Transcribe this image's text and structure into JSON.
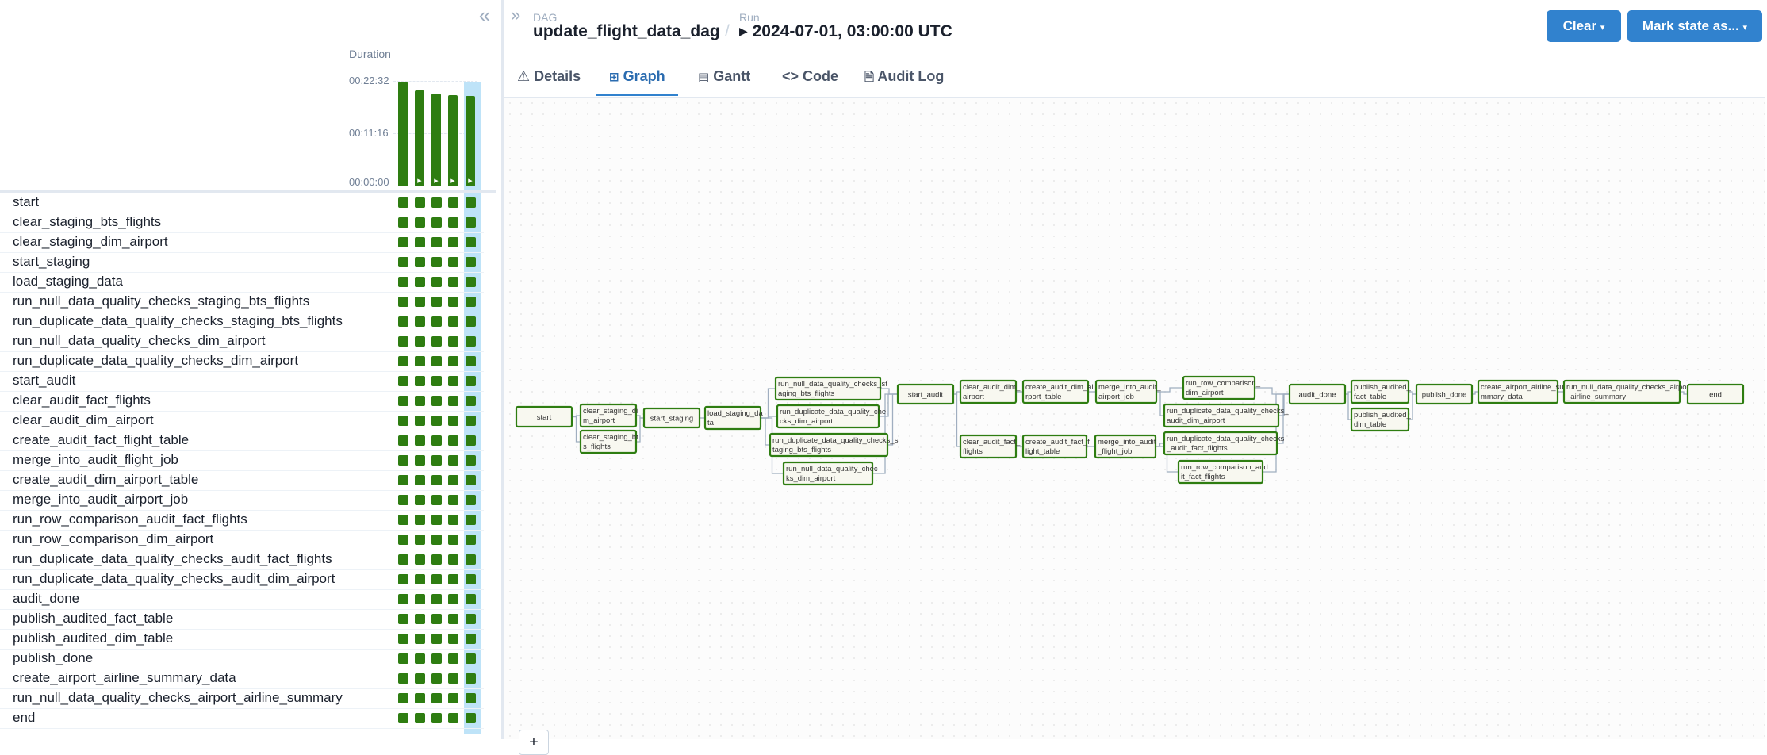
{
  "grid": {
    "duration_label": "Duration",
    "ticks": [
      "00:22:32",
      "00:11:16",
      "00:00:00"
    ],
    "runs": [
      {
        "duration_fraction": 1.0,
        "has_play": false
      },
      {
        "duration_fraction": 0.92,
        "has_play": true
      },
      {
        "duration_fraction": 0.89,
        "has_play": true
      },
      {
        "duration_fraction": 0.87,
        "has_play": true
      },
      {
        "duration_fraction": 0.86,
        "has_play": true
      }
    ],
    "tasks": [
      "start",
      "clear_staging_bts_flights",
      "clear_staging_dim_airport",
      "start_staging",
      "load_staging_data",
      "run_null_data_quality_checks_staging_bts_flights",
      "run_duplicate_data_quality_checks_staging_bts_flights",
      "run_null_data_quality_checks_dim_airport",
      "run_duplicate_data_quality_checks_dim_airport",
      "start_audit",
      "clear_audit_fact_flights",
      "clear_audit_dim_airport",
      "create_audit_fact_flight_table",
      "merge_into_audit_flight_job",
      "create_audit_dim_airport_table",
      "merge_into_audit_airport_job",
      "run_row_comparison_audit_fact_flights",
      "run_row_comparison_dim_airport",
      "run_duplicate_data_quality_checks_audit_fact_flights",
      "run_duplicate_data_quality_checks_audit_dim_airport",
      "audit_done",
      "publish_audited_fact_table",
      "publish_audited_dim_table",
      "publish_done",
      "create_airport_airline_summary_data",
      "run_null_data_quality_checks_airport_airline_summary",
      "end"
    ]
  },
  "header": {
    "dag_label": "DAG",
    "dag_id": "update_flight_data_dag",
    "run_label": "Run",
    "run_id": "2024-07-01, 03:00:00 UTC",
    "clear_button": "Clear",
    "mark_state_button": "Mark state as..."
  },
  "tabs": [
    "Details",
    "Graph",
    "Gantt",
    "Code",
    "Audit Log"
  ],
  "active_tab": "Graph",
  "colors": {
    "success": "#2e7d11",
    "accent": "#3182ce",
    "node_fill": "#f8f8f0"
  },
  "graph": {
    "zoom_in": "+",
    "nodes": [
      {
        "id": "start",
        "lines": [
          "start"
        ]
      },
      {
        "id": "clear_staging_dim_airport",
        "lines": [
          "clear_staging_di",
          "m_airport"
        ]
      },
      {
        "id": "clear_staging_bts_flights",
        "lines": [
          "clear_staging_bt",
          "s_flights"
        ]
      },
      {
        "id": "start_staging",
        "lines": [
          "start_staging"
        ]
      },
      {
        "id": "load_staging_data",
        "lines": [
          "load_staging_da",
          "ta"
        ]
      },
      {
        "id": "null_stg_bts",
        "lines": [
          "run_null_data_quality_checks_st",
          "aging_bts_flights"
        ]
      },
      {
        "id": "dup_dim_airport",
        "lines": [
          "run_duplicate_data_quality_che",
          "cks_dim_airport"
        ]
      },
      {
        "id": "dup_stg_bts",
        "lines": [
          "run_duplicate_data_quality_checks_s",
          "taging_bts_flights"
        ]
      },
      {
        "id": "null_dim_airport",
        "lines": [
          "run_null_data_quality_chec",
          "ks_dim_airport"
        ]
      },
      {
        "id": "start_audit",
        "lines": [
          "start_audit"
        ]
      },
      {
        "id": "clear_audit_dim_airport",
        "lines": [
          "clear_audit_dim_",
          "airport"
        ]
      },
      {
        "id": "create_audit_dim_airport_table",
        "lines": [
          "create_audit_dim_ai",
          "rport_table"
        ]
      },
      {
        "id": "merge_into_audit_airport_job",
        "lines": [
          "merge_into_audit_",
          "airport_job"
        ]
      },
      {
        "id": "row_cmp_dim",
        "lines": [
          "run_row_comparison_",
          "dim_airport"
        ]
      },
      {
        "id": "dup_audit_dim",
        "lines": [
          "run_duplicate_data_quality_checks_",
          "audit_dim_airport"
        ]
      },
      {
        "id": "clear_audit_fact_flights",
        "lines": [
          "clear_audit_fact_",
          "flights"
        ]
      },
      {
        "id": "create_audit_fact_flight_table",
        "lines": [
          "create_audit_fact_f",
          "light_table"
        ]
      },
      {
        "id": "merge_into_audit_flight_job",
        "lines": [
          "merge_into_audit",
          "_flight_job"
        ]
      },
      {
        "id": "dup_audit_fact",
        "lines": [
          "run_duplicate_data_quality_checks",
          "_audit_fact_flights"
        ]
      },
      {
        "id": "row_cmp_fact",
        "lines": [
          "run_row_comparison_aud",
          "it_fact_flights"
        ]
      },
      {
        "id": "audit_done",
        "lines": [
          "audit_done"
        ]
      },
      {
        "id": "publish_fact",
        "lines": [
          "publish_audited_",
          "fact_table"
        ]
      },
      {
        "id": "publish_dim",
        "lines": [
          "publish_audited_",
          "dim_table"
        ]
      },
      {
        "id": "publish_done",
        "lines": [
          "publish_done"
        ]
      },
      {
        "id": "create_summary",
        "lines": [
          "create_airport_airline_su",
          "mmary_data"
        ]
      },
      {
        "id": "null_summary",
        "lines": [
          "run_null_data_quality_checks_airport",
          "_airline_summary"
        ]
      },
      {
        "id": "end",
        "lines": [
          "end"
        ]
      }
    ],
    "edges": [
      [
        "start",
        "clear_staging_dim_airport"
      ],
      [
        "start",
        "clear_staging_bts_flights"
      ],
      [
        "clear_staging_dim_airport",
        "start_staging"
      ],
      [
        "clear_staging_bts_flights",
        "start_staging"
      ],
      [
        "start_staging",
        "load_staging_data"
      ],
      [
        "load_staging_data",
        "null_stg_bts"
      ],
      [
        "load_staging_data",
        "dup_dim_airport"
      ],
      [
        "load_staging_data",
        "dup_stg_bts"
      ],
      [
        "load_staging_data",
        "null_dim_airport"
      ],
      [
        "null_stg_bts",
        "start_audit"
      ],
      [
        "dup_dim_airport",
        "start_audit"
      ],
      [
        "dup_stg_bts",
        "start_audit"
      ],
      [
        "null_dim_airport",
        "start_audit"
      ],
      [
        "start_audit",
        "clear_audit_dim_airport"
      ],
      [
        "start_audit",
        "clear_audit_fact_flights"
      ],
      [
        "clear_audit_dim_airport",
        "create_audit_dim_airport_table"
      ],
      [
        "create_audit_dim_airport_table",
        "merge_into_audit_airport_job"
      ],
      [
        "merge_into_audit_airport_job",
        "row_cmp_dim"
      ],
      [
        "merge_into_audit_airport_job",
        "dup_audit_dim"
      ],
      [
        "clear_audit_fact_flights",
        "create_audit_fact_flight_table"
      ],
      [
        "create_audit_fact_flight_table",
        "merge_into_audit_flight_job"
      ],
      [
        "merge_into_audit_flight_job",
        "dup_audit_fact"
      ],
      [
        "merge_into_audit_flight_job",
        "row_cmp_fact"
      ],
      [
        "row_cmp_dim",
        "audit_done"
      ],
      [
        "dup_audit_dim",
        "audit_done"
      ],
      [
        "dup_audit_fact",
        "audit_done"
      ],
      [
        "row_cmp_fact",
        "audit_done"
      ],
      [
        "audit_done",
        "publish_fact"
      ],
      [
        "audit_done",
        "publish_dim"
      ],
      [
        "publish_fact",
        "publish_done"
      ],
      [
        "publish_dim",
        "publish_done"
      ],
      [
        "publish_done",
        "create_summary"
      ],
      [
        "create_summary",
        "null_summary"
      ],
      [
        "null_summary",
        "end"
      ]
    ]
  }
}
